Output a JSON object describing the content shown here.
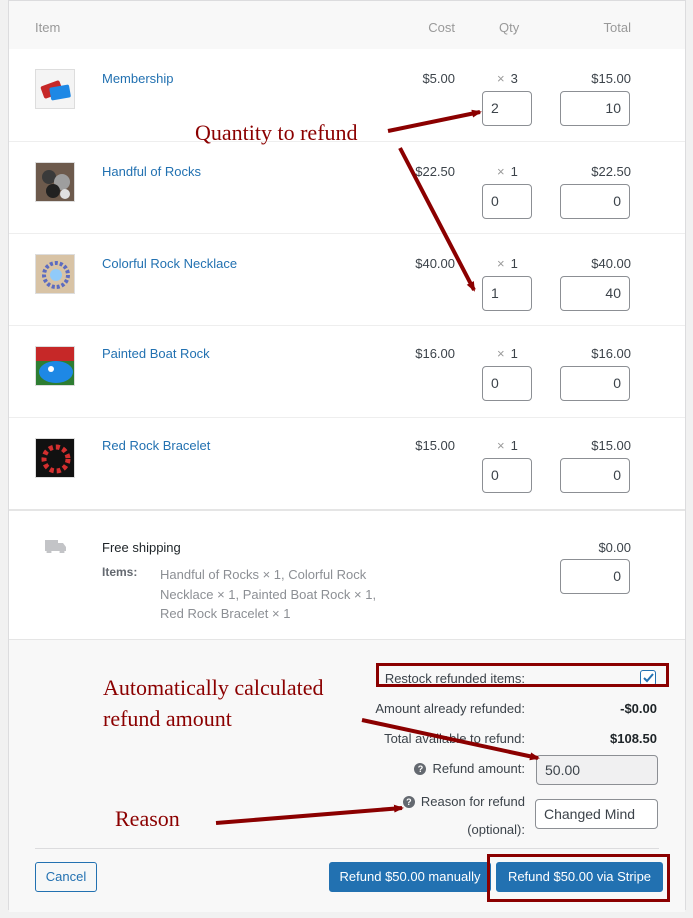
{
  "header": {
    "item": "Item",
    "cost": "Cost",
    "qty": "Qty",
    "total": "Total"
  },
  "items": [
    {
      "name": "Membership",
      "cost": "$5.00",
      "qty_mult": "×",
      "qty": "3",
      "total": "$15.00",
      "refund_qty": "2",
      "refund_total": "10",
      "thumb_icon": "credit-cards-icon"
    },
    {
      "name": "Handful of Rocks",
      "cost": "$22.50",
      "qty_mult": "×",
      "qty": "1",
      "total": "$22.50",
      "refund_qty": "0",
      "refund_total": "0",
      "thumb_icon": "rocks-icon"
    },
    {
      "name": "Colorful Rock Necklace",
      "cost": "$40.00",
      "qty_mult": "×",
      "qty": "1",
      "total": "$40.00",
      "refund_qty": "1",
      "refund_total": "40",
      "thumb_icon": "necklace-icon"
    },
    {
      "name": "Painted Boat Rock",
      "cost": "$16.00",
      "qty_mult": "×",
      "qty": "1",
      "total": "$16.00",
      "refund_qty": "0",
      "refund_total": "0",
      "thumb_icon": "boat-rock-icon"
    },
    {
      "name": "Red Rock Bracelet",
      "cost": "$15.00",
      "qty_mult": "×",
      "qty": "1",
      "total": "$15.00",
      "refund_qty": "0",
      "refund_total": "0",
      "thumb_icon": "bracelet-icon"
    }
  ],
  "shipping": {
    "method": "Free shipping",
    "items_label": "Items:",
    "items_line1": "Handful of Rocks × 1, Colorful Rock",
    "items_line2": "Necklace × 1, Painted Boat Rock × 1,",
    "items_line3": "Red Rock Bracelet × 1",
    "total": "$0.00",
    "refund_total": "0",
    "icon": "truck-icon"
  },
  "refund": {
    "restock_label": "Restock refunded items:",
    "restock_checked": true,
    "already_label": "Amount already refunded:",
    "already_value": "-$0.00",
    "available_label": "Total available to refund:",
    "available_value": "$108.50",
    "amount_label": "Refund amount:",
    "amount_value": "50.00",
    "reason_label_1": "Reason for refund",
    "reason_label_2": "(optional):",
    "reason_value": "Changed Mind"
  },
  "actions": {
    "cancel": "Cancel",
    "manual": "Refund $50.00 manually",
    "stripe": "Refund $50.00 via Stripe"
  },
  "annotations": {
    "quantity": "Quantity to refund",
    "auto_line1": "Automatically calculated",
    "auto_line2": "refund amount",
    "reason": "Reason",
    "color": "#8b0000"
  },
  "colors": {
    "link": "#2271b1",
    "primary": "#2271b1",
    "annotation": "#8b0000"
  }
}
